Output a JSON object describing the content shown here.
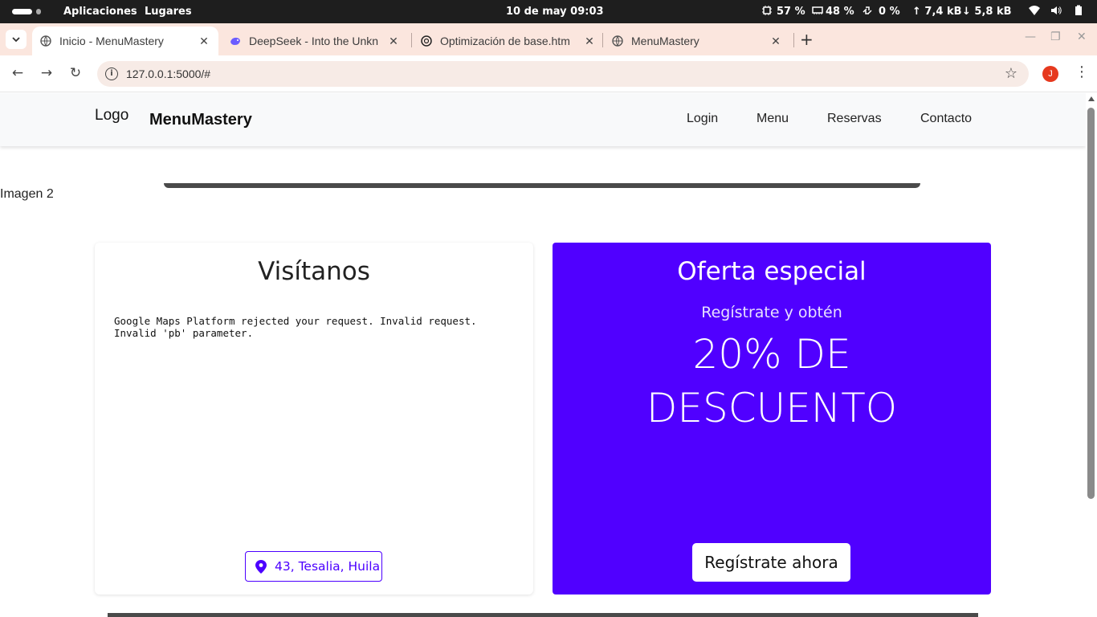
{
  "system_bar": {
    "apps_label": "Aplicaciones",
    "places_label": "Lugares",
    "datetime": "10 de may  09:03",
    "cpu": "57 %",
    "memory": "48 %",
    "swap": "0 %",
    "upload": "↑ 7,4 kB",
    "download": "↓ 5,8 kB"
  },
  "tabs": [
    {
      "title": "Inicio - MenuMastery",
      "active": true
    },
    {
      "title": "DeepSeek - Into the Unkn",
      "active": false
    },
    {
      "title": "Optimización de base.htm",
      "active": false
    },
    {
      "title": "MenuMastery",
      "active": false
    }
  ],
  "address_bar": {
    "url": "127.0.0.1:5000/#",
    "profile_initial": "J"
  },
  "site": {
    "logo_alt": "Logo",
    "brand": "MenuMastery",
    "nav": [
      "Login",
      "Menu",
      "Reservas",
      "Contacto"
    ],
    "carousel_image_alt": "Imagen 2",
    "visit_card": {
      "title": "Visítanos",
      "map_error": "Google Maps Platform rejected your request. Invalid request.\nInvalid 'pb' parameter.",
      "address": "43, Tesalia, Huila"
    },
    "offer_card": {
      "title": "Oferta especial",
      "subtitle": "Regístrate y obtén",
      "discount": "20% DE DESCUENTO",
      "button": "Regístrate ahora"
    }
  },
  "colors": {
    "accent": "#5000ff",
    "tabstrip": "#fbe6de",
    "navbar": "#f8f9fa"
  }
}
